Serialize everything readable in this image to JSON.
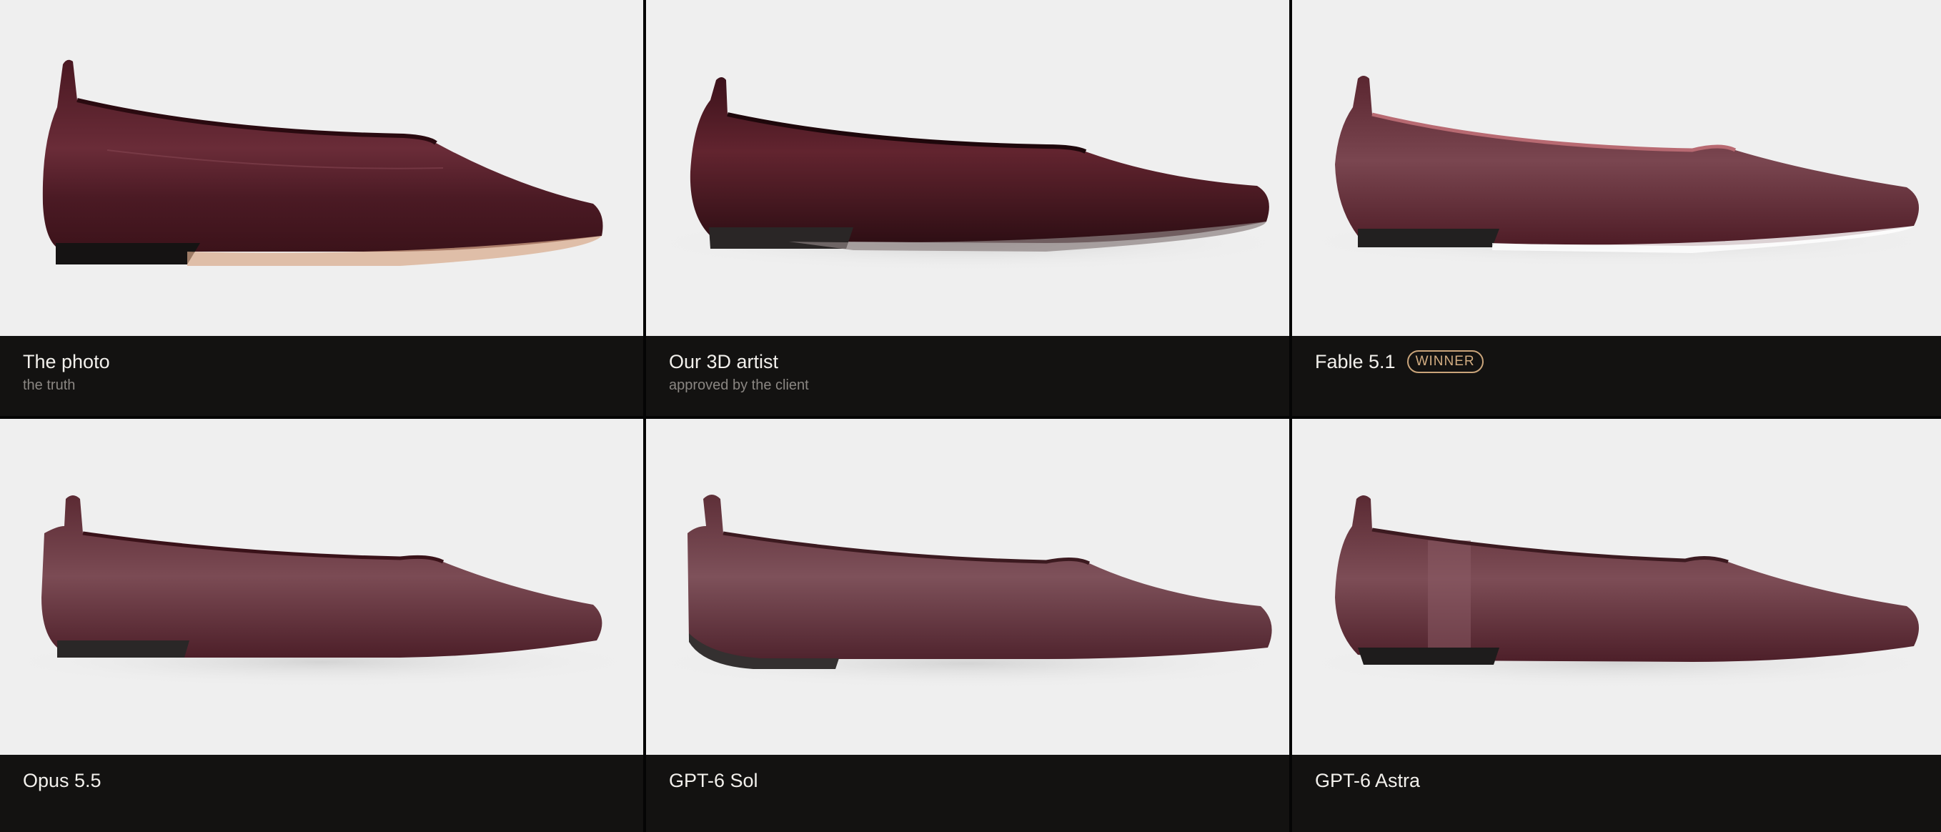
{
  "panels": [
    {
      "title": "The photo",
      "subtitle": "the truth",
      "badge": ""
    },
    {
      "title": "Our 3D artist",
      "subtitle": "approved by the client",
      "badge": ""
    },
    {
      "title": "Fable 5.1",
      "subtitle": "",
      "badge": "WINNER"
    },
    {
      "title": "Opus 5.5",
      "subtitle": "",
      "badge": ""
    },
    {
      "title": "GPT-6 Sol",
      "subtitle": "",
      "badge": ""
    },
    {
      "title": "GPT-6 Astra",
      "subtitle": "",
      "badge": ""
    }
  ],
  "colors": {
    "leather": "#5a1f2a",
    "leather_light": "#6e3a44",
    "sole": "#1a1818",
    "background": "#efefef",
    "caption_bg": "#131211",
    "badge": "#c9a47a"
  }
}
